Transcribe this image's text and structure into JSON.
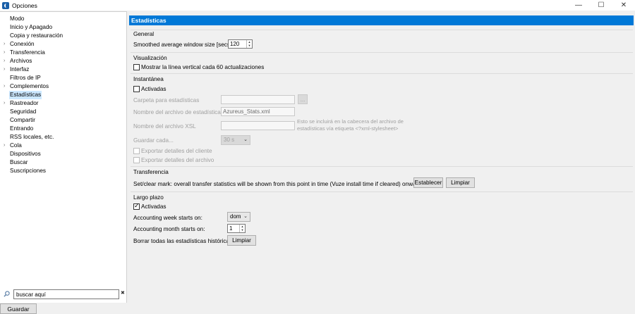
{
  "window": {
    "title": "Opciones",
    "minimize": "—",
    "maximize": "☐",
    "close": "✕"
  },
  "sidebar": {
    "items": [
      {
        "label": "Modo",
        "arrow": false,
        "selected": false
      },
      {
        "label": "Inicio y Apagado",
        "arrow": false,
        "selected": false
      },
      {
        "label": "Copia y restauración",
        "arrow": false,
        "selected": false
      },
      {
        "label": "Conexión",
        "arrow": true,
        "selected": false
      },
      {
        "label": "Transferencia",
        "arrow": true,
        "selected": false
      },
      {
        "label": "Archivos",
        "arrow": true,
        "selected": false
      },
      {
        "label": "Interfaz",
        "arrow": true,
        "selected": false
      },
      {
        "label": "Filtros de IP",
        "arrow": false,
        "selected": false
      },
      {
        "label": "Complementos",
        "arrow": true,
        "selected": false
      },
      {
        "label": "Estadísticas",
        "arrow": false,
        "selected": true
      },
      {
        "label": "Rastreador",
        "arrow": true,
        "selected": false
      },
      {
        "label": "Seguridad",
        "arrow": false,
        "selected": false
      },
      {
        "label": "Compartir",
        "arrow": false,
        "selected": false
      },
      {
        "label": "Entrando",
        "arrow": false,
        "selected": false
      },
      {
        "label": "RSS locales, etc.",
        "arrow": false,
        "selected": false
      },
      {
        "label": "Cola",
        "arrow": true,
        "selected": false
      },
      {
        "label": "Dispositivos",
        "arrow": false,
        "selected": false
      },
      {
        "label": "Buscar",
        "arrow": false,
        "selected": false
      },
      {
        "label": "Suscripciones",
        "arrow": false,
        "selected": false
      }
    ],
    "search_value": "buscar aquí",
    "search_clear": "✖"
  },
  "footer": {
    "save_label": "Guardar"
  },
  "page": {
    "title": "Estadísticas",
    "general": {
      "title": "General",
      "window_size_label": "Smoothed average window size [secs]",
      "window_size_value": "120"
    },
    "visualizacion": {
      "title": "Visualización",
      "vertical_line_label": "Mostrar la línea vertical cada 60 actualizaciones"
    },
    "instantanea": {
      "title": "Instantánea",
      "activadas_label": "Activadas",
      "folder_label": "Carpeta para estadísticas",
      "browse_label": "...",
      "filename_label": "Nombre del archivo de estadísticas",
      "filename_value": "Azureus_Stats.xml",
      "xsl_label": "Nombre del archivo XSL",
      "xsl_note_1": "Esto se incluirá en la cabecera del archivo de",
      "xsl_note_2": "estadísticas vía etiqueta <?xml-stylesheet>",
      "save_every_label": "Guardar cada...",
      "save_every_value": "30 s",
      "export_client_label": "Exportar detalles del cliente",
      "export_file_label": "Exportar detalles del archivo"
    },
    "transferencia": {
      "title": "Transferencia",
      "text": "Set/clear mark: overall transfer statistics will be shown from this point in time (Vuze install time if cleared) onwards",
      "set_label": "Establecer",
      "clear_label": "Limpiar"
    },
    "largo_plazo": {
      "title": "Largo plazo",
      "activadas_label": "Activadas",
      "week_label": "Accounting week starts on:",
      "week_value": "dom",
      "month_label": "Accounting month starts on:",
      "month_value": "1",
      "clear_history_label": "Borrar todas las estadísticas históricas",
      "clear_history_button": "Limpiar"
    }
  }
}
